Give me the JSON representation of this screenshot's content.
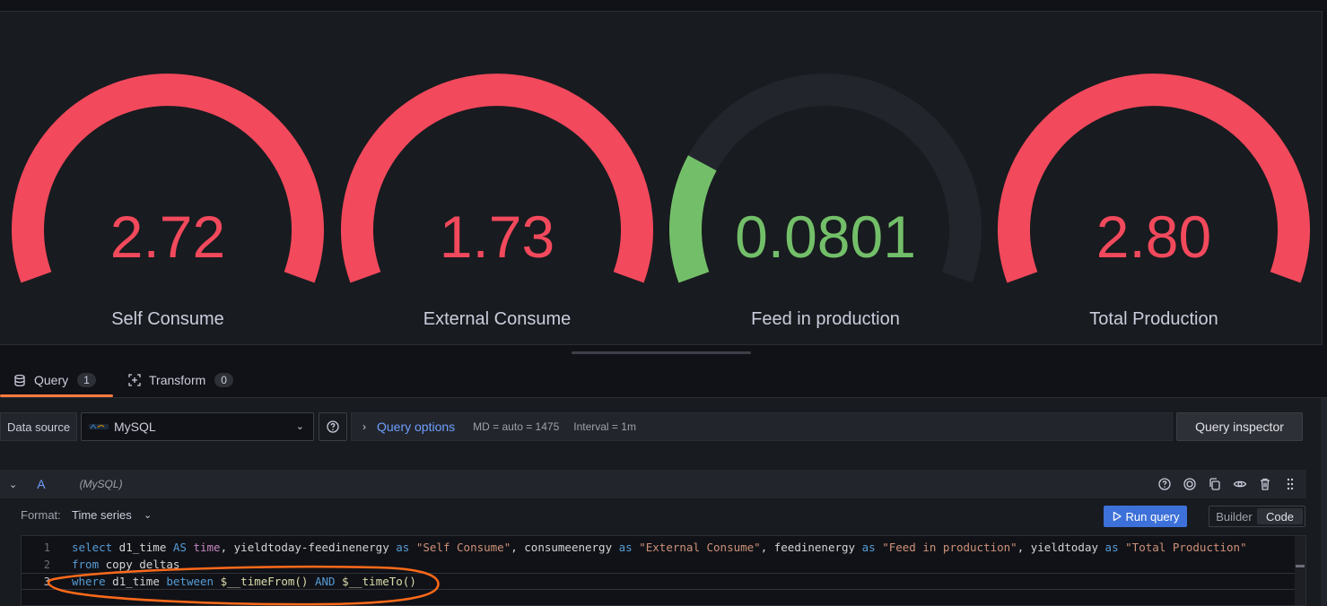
{
  "gauges": [
    {
      "value": "2.72",
      "label": "Self Consume",
      "fill": 1.0,
      "color": "#f2495c"
    },
    {
      "value": "1.73",
      "label": "External Consume",
      "fill": 1.0,
      "color": "#f2495c"
    },
    {
      "value": "0.0801",
      "label": "Feed in production",
      "fill": 0.22,
      "color": "#73bf69"
    },
    {
      "value": "2.80",
      "label": "Total Production",
      "fill": 1.0,
      "color": "#f2495c"
    }
  ],
  "tabs": {
    "query": {
      "label": "Query",
      "count": "1"
    },
    "transform": {
      "label": "Transform",
      "count": "0"
    }
  },
  "datasource": {
    "label": "Data source",
    "selected": "MySQL"
  },
  "query_options": {
    "title": "Query options",
    "md": "MD = auto = 1475",
    "interval": "Interval = 1m"
  },
  "query_inspector": "Query inspector",
  "query_row": {
    "letter": "A",
    "datasource": "(MySQL)"
  },
  "format": {
    "label": "Format:",
    "value": "Time series"
  },
  "run_query": "Run query",
  "mode": {
    "builder": "Builder",
    "code": "Code"
  },
  "code": {
    "line_numbers": [
      "1",
      "2",
      "3"
    ],
    "line1": {
      "t1": "select",
      "t2": " d1_time ",
      "t3": "AS",
      "t4": " ",
      "t5": "time",
      "t6": ", yieldtoday-feedinenergy ",
      "t7": "as",
      "t8": " ",
      "t9": "\"Self Consume\"",
      "t10": ", consumeenergy ",
      "t11": "as",
      "t12": " ",
      "t13": "\"External Consume\"",
      "t14": ", feedinenergy ",
      "t15": "as",
      "t16": " ",
      "t17": "\"Feed in production\"",
      "t18": ", yieldtoday ",
      "t19": "as",
      "t20": " ",
      "t21": "\"Total Production\""
    },
    "line2": {
      "t1": "from",
      "t2": " copy_deltas"
    },
    "line3": {
      "t1": "where",
      "t2": " d1_time ",
      "t3": "between",
      "t4": " ",
      "t5": "$__timeFrom()",
      "t6": " ",
      "t7": "AND",
      "t8": " ",
      "t9": "$__timeTo()"
    }
  },
  "colors": {
    "accent_orange": "#ff7a3d",
    "link_blue": "#6e9fff",
    "primary_button": "#3d71d9",
    "annotation": "#ff6a1a"
  }
}
